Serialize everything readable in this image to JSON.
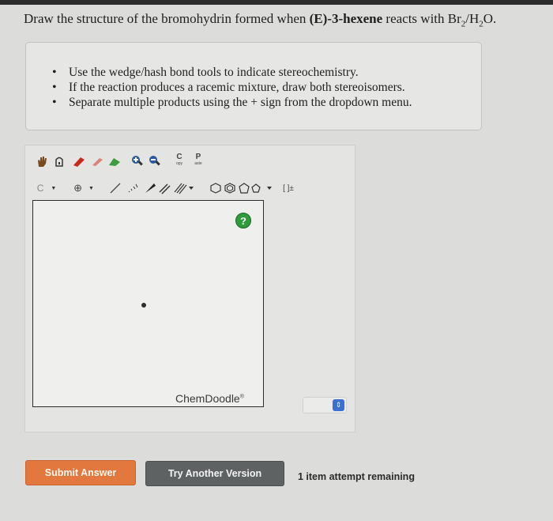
{
  "question": {
    "prefix": "Draw the structure of the bromohydrin formed when ",
    "compound": "(E)-3-hexene",
    "mid": " reacts with Br",
    "sub1": "2",
    "mid2": "/H",
    "sub2": "2",
    "suffix": "O."
  },
  "instructions": [
    "Use the wedge/hash bond tools to indicate stereochemistry.",
    "If the reaction produces a racemic mixture, draw both stereoisomers.",
    "Separate multiple products using the + sign from the dropdown menu."
  ],
  "toolbar": {
    "copy_letter": "C",
    "copy_caption": "opy",
    "paste_letter": "P",
    "paste_caption": "aste",
    "element_select": "C",
    "charge_symbol": "⊕",
    "bracket_label": "[ ]±"
  },
  "editor": {
    "help_label": "?",
    "brand": "ChemDoodle",
    "brand_mark": "®"
  },
  "buttons": {
    "submit": "Submit Answer",
    "try_another": "Try Another Version"
  },
  "attempts_text": "1 item attempt remaining",
  "colors": {
    "submit": "#e2783e",
    "try_another": "#5f6263",
    "help": "#2f9b3c"
  }
}
